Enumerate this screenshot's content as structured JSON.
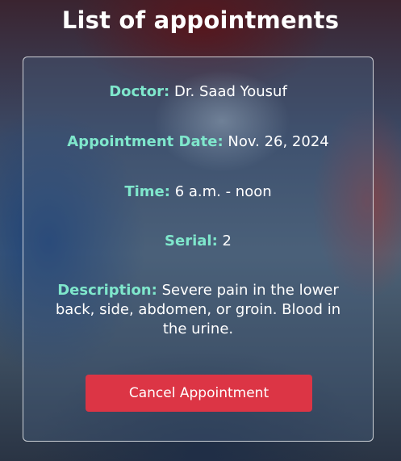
{
  "page": {
    "title": "List of appointments"
  },
  "appointment": {
    "doctor_label": "Doctor:",
    "doctor_value": "Dr. Saad Yousuf",
    "date_label": "Appointment Date:",
    "date_value": "Nov. 26, 2024",
    "time_label": "Time:",
    "time_value": "6 a.m. - noon",
    "serial_label": "Serial:",
    "serial_value": "2",
    "description_label": "Description:",
    "description_value": "Severe pain in the lower back, side, abdomen, or groin. Blood in the urine.",
    "cancel_label": "Cancel Appointment"
  },
  "colors": {
    "label_accent": "#7fe7cc",
    "cancel_button": "#dc3545"
  }
}
